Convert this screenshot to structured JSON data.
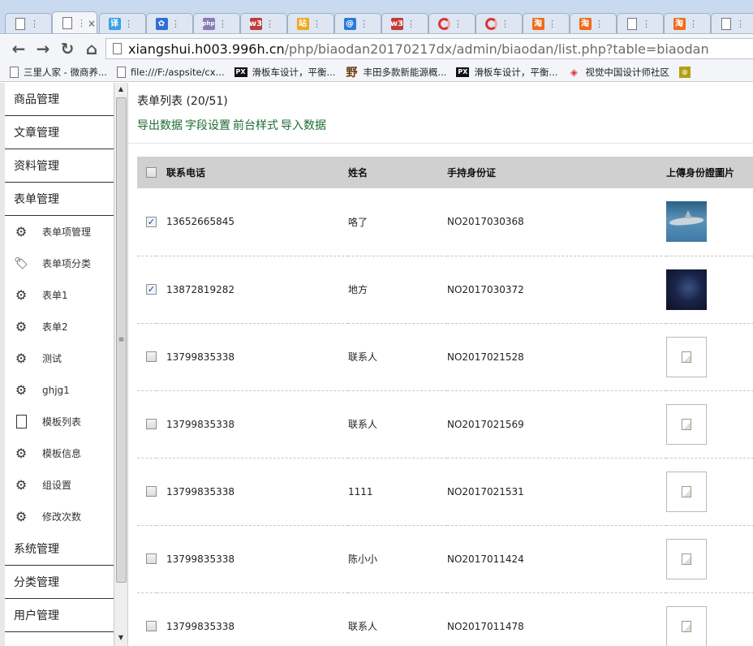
{
  "browser": {
    "tabs": [
      {
        "icon": "page-icon",
        "active": false
      },
      {
        "icon": "page-icon",
        "active": true
      },
      {
        "icon": "translate-icon",
        "glyph": "译",
        "color": "#3aa0e8"
      },
      {
        "icon": "paw-icon",
        "glyph": "✿",
        "color": "#2f6fd6"
      },
      {
        "icon": "php-icon",
        "glyph": "php",
        "color": "#8a7ab8"
      },
      {
        "icon": "w3-icon",
        "glyph": "w3",
        "color": "#c23b3b"
      },
      {
        "icon": "zhan-icon",
        "glyph": "站",
        "color": "#f0a820"
      },
      {
        "icon": "at-icon",
        "glyph": "@",
        "color": "#2b7bd6"
      },
      {
        "icon": "w3-icon",
        "glyph": "w3",
        "color": "#c23b3b"
      },
      {
        "icon": "swirl-icon"
      },
      {
        "icon": "swirl-icon"
      },
      {
        "icon": "taobao-icon",
        "glyph": "淘",
        "color": "#f26b1d"
      },
      {
        "icon": "taobao-icon",
        "glyph": "淘",
        "color": "#f26b1d"
      },
      {
        "icon": "page-icon"
      },
      {
        "icon": "taobao-icon",
        "glyph": "淘",
        "color": "#f26b1d"
      },
      {
        "icon": "page-icon"
      }
    ],
    "url_host": "xiangshui.h003.996h.cn",
    "url_path": "/php/biaodan20170217dx/admin/biaodan/list.php?table=biaodan",
    "bookmarks": [
      {
        "icon": "page",
        "label": "三里人家 - 微商养..."
      },
      {
        "icon": "page",
        "label": "file:///F:/aspsite/cx..."
      },
      {
        "icon": "px",
        "label": "滑板车设计，平衡..."
      },
      {
        "icon": "ye",
        "label": "丰田多款新能源概..."
      },
      {
        "icon": "px",
        "label": "滑板车设计，平衡..."
      },
      {
        "icon": "eye",
        "label": "视觉中国设计师社区"
      },
      {
        "icon": "gr",
        "label": ""
      }
    ]
  },
  "sidebar": {
    "top_menus": [
      "商品管理",
      "文章管理",
      "资料管理",
      "表单管理"
    ],
    "sub_items": [
      {
        "icon": "gear",
        "label": "表单项管理"
      },
      {
        "icon": "tag",
        "label": "表单项分类"
      },
      {
        "icon": "gear",
        "label": "表单1"
      },
      {
        "icon": "gear",
        "label": "表单2"
      },
      {
        "icon": "gear",
        "label": "测试"
      },
      {
        "icon": "gear",
        "label": "ghjg1"
      },
      {
        "icon": "doc",
        "label": "模板列表"
      },
      {
        "icon": "gear",
        "label": "模板信息"
      },
      {
        "icon": "gear",
        "label": "组设置"
      },
      {
        "icon": "gear",
        "label": "修改次数"
      }
    ],
    "bottom_menus": [
      "系统管理",
      "分类管理",
      "用户管理"
    ]
  },
  "main": {
    "title": "表单列表 (20/51)",
    "actions": [
      "导出数据",
      "字段设置",
      "前台样式",
      "导入数据"
    ],
    "columns": [
      "联系电话",
      "姓名",
      "手持身份证",
      "上傳身份證圖片"
    ],
    "rows": [
      {
        "checked": true,
        "phone": "13652665845",
        "name": "咯了",
        "id": "NO2017030368",
        "image": "shark"
      },
      {
        "checked": true,
        "phone": "13872819282",
        "name": "地方",
        "id": "NO2017030372",
        "image": "night"
      },
      {
        "checked": false,
        "phone": "13799835338",
        "name": "联系人",
        "id": "NO2017021528",
        "image": "broken"
      },
      {
        "checked": false,
        "phone": "13799835338",
        "name": "联系人",
        "id": "NO2017021569",
        "image": "broken"
      },
      {
        "checked": false,
        "phone": "13799835338",
        "name": "1111",
        "id": "NO2017021531",
        "image": "broken"
      },
      {
        "checked": false,
        "phone": "13799835338",
        "name": "陈小小",
        "id": "NO2017011424",
        "image": "broken"
      },
      {
        "checked": false,
        "phone": "13799835338",
        "name": "联系人",
        "id": "NO2017011478",
        "image": "broken"
      }
    ]
  }
}
